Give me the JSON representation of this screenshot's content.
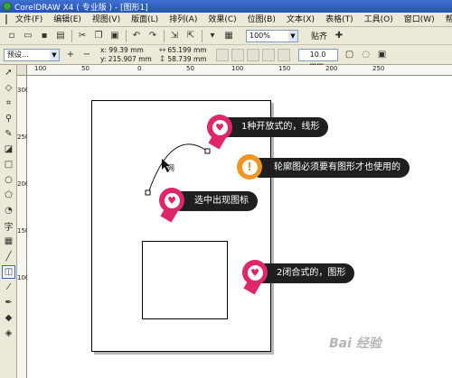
{
  "window": {
    "title": "CorelDRAW X4 ( 专业版 ) - [图形1]"
  },
  "menu": [
    "文件(F)",
    "编辑(E)",
    "视图(V)",
    "版面(L)",
    "排列(A)",
    "效果(C)",
    "位图(B)",
    "文本(X)",
    "表格(T)",
    "工具(O)",
    "窗口(W)",
    "帮助(H)"
  ],
  "toolbar": {
    "zoom": "100%",
    "snap": "贴齐"
  },
  "propbar": {
    "preset": "预设...",
    "x": "x: 99.39 mm",
    "y": "y: 215.907 mm",
    "w": "65.199 mm",
    "h": "58.739 mm",
    "outline": "10.0 mm"
  },
  "rulers": {
    "top": [
      "100",
      "50",
      "0",
      "50",
      "100",
      "150",
      "200",
      "250"
    ],
    "left": [
      "300",
      "250",
      "200",
      "150",
      "100"
    ]
  },
  "callouts": {
    "open_shape": "1种开放式的，线形",
    "note": "轮廓图必须要有图形才也使用的",
    "cursor_icon": "选中出现图标",
    "closed_shape": "2闭合式的，图形"
  },
  "cursor_label": "网",
  "watermark": "Bai 经验",
  "colors": {
    "pin_pink": "#e0266b",
    "pin_orange": "#f29422",
    "pill_bg": "#1f1f1f"
  }
}
